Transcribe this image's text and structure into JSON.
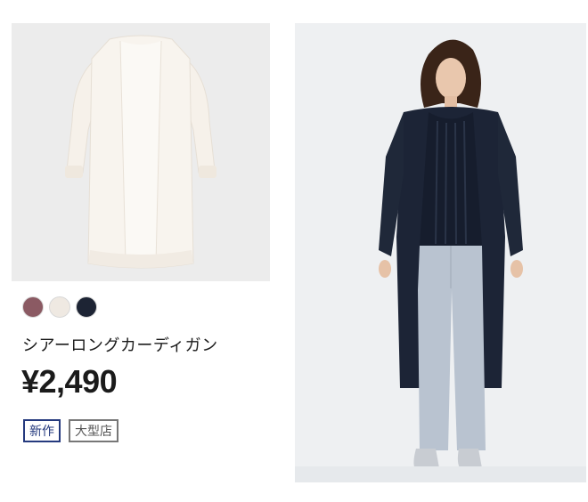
{
  "product": {
    "name": "シアーロングカーディガン",
    "price": "¥2,490",
    "colors": [
      {
        "name": "pink",
        "hex": "#8b5a63"
      },
      {
        "name": "off-white",
        "hex": "#efe9e2"
      },
      {
        "name": "navy",
        "hex": "#1d2434"
      }
    ],
    "badges": {
      "new": "新作",
      "large_store": "大型店"
    }
  }
}
